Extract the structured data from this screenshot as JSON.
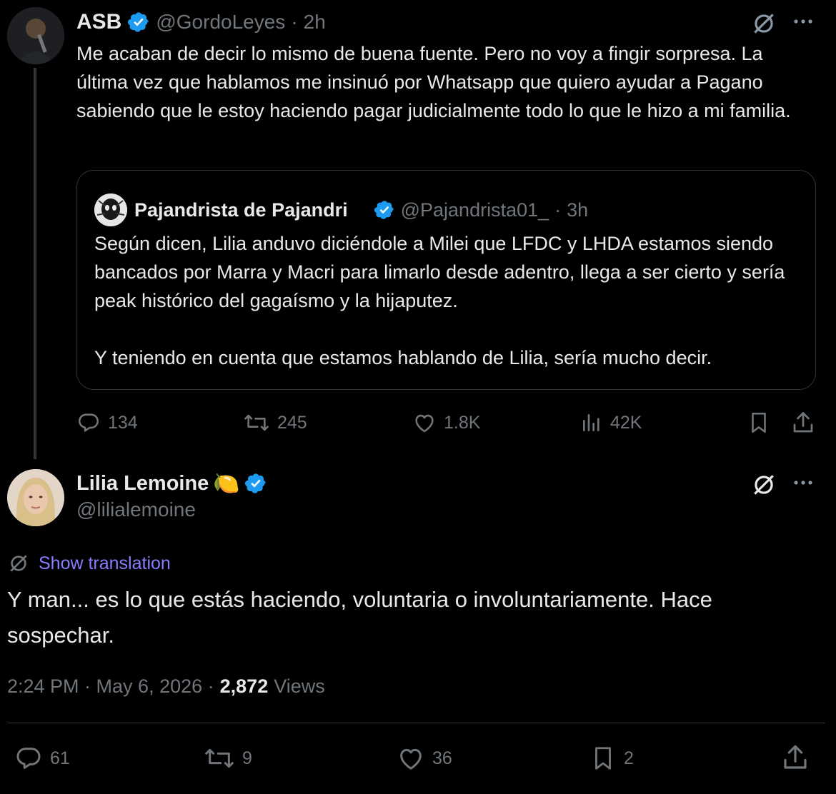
{
  "parent": {
    "display_name": "ASB",
    "handle": "@GordoLeyes",
    "time": "2h",
    "text": "Me acaban de decir lo mismo de buena fuente. Pero no voy a fingir sorpresa. La última vez que hablamos me insinuó por Whatsapp que quiero ayudar a Pagano sabiendo que le estoy haciendo pagar judicialmente todo lo que le hizo a mi familia.",
    "quote": {
      "display_name": "Pajandrista de Pajandri",
      "handle": "@Pajandrista01_",
      "time": "3h",
      "paragraph1": "Según dicen, Lilia anduvo diciéndole a Milei que LFDC y LHDA estamos siendo bancados por Marra y Macri para limarlo desde adentro, llega a ser cierto y sería peak histórico del gagaísmo y la hijaputez.",
      "paragraph2": "Y teniendo en cuenta que estamos hablando de Lilia, sería mucho decir."
    },
    "stats": {
      "replies": "134",
      "reposts": "245",
      "likes": "1.8K",
      "views": "42K"
    }
  },
  "main": {
    "display_name": "Lilia Lemoine",
    "emoji": "🍋",
    "handle": "@lilialemoine",
    "translate_label": "Show translation",
    "text": "Y man... es lo que estás haciendo, voluntaria o involuntariamente. Hace sospechar.",
    "timestamp": "2:24 PM · May 6, 2026 ·",
    "views_count": "2,872",
    "views_label": "Views",
    "stats": {
      "replies": "61",
      "reposts": "9",
      "likes": "36",
      "bookmarks": "2"
    }
  },
  "colors": {
    "background": "#000000",
    "text": "#e7e9ea",
    "muted": "#71767b",
    "verified": "#1d9bf0",
    "link": "#8a7cff",
    "border": "#2f3336"
  },
  "icons": [
    "no-translate-icon",
    "more-icon",
    "verified-icon",
    "reply-icon",
    "repost-icon",
    "like-icon",
    "views-icon",
    "bookmark-icon",
    "share-icon"
  ]
}
